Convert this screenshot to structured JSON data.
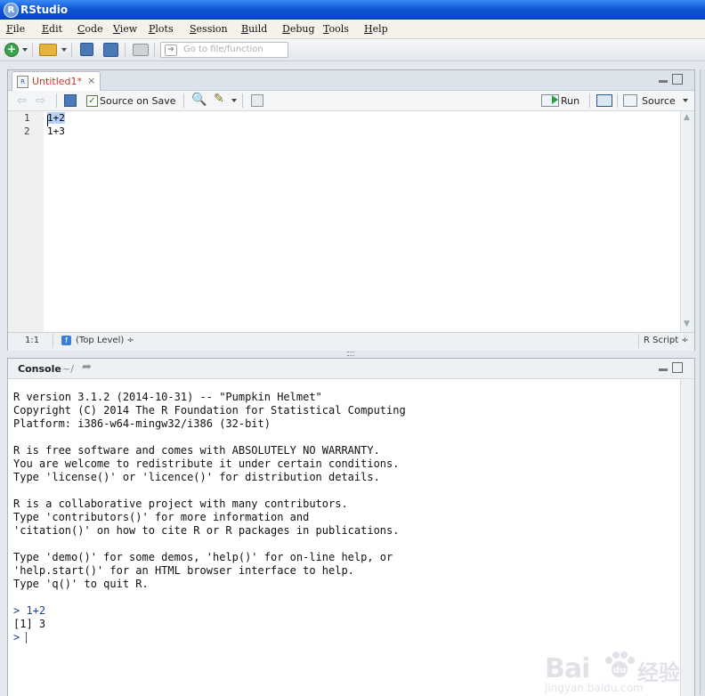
{
  "window": {
    "title": "RStudio"
  },
  "menu": [
    "File",
    "Edit",
    "Code",
    "View",
    "Plots",
    "Session",
    "Build",
    "Debug",
    "Tools",
    "Help"
  ],
  "toolbar": {
    "goto_placeholder": "Go to file/function"
  },
  "editor": {
    "tab_label": "Untitled1*",
    "tab_close": "×",
    "source_on_save_label": "Source on Save",
    "source_on_save_checked": true,
    "run_label": "Run",
    "source_label": "Source",
    "line_numbers": [
      "1",
      "2"
    ],
    "lines": [
      {
        "selected": "1+2",
        "rest": ""
      },
      {
        "selected": "",
        "rest": "1+3"
      }
    ],
    "status_position": "1:1",
    "status_scope": "(Top Level) ÷",
    "status_filetype": "R Script ÷"
  },
  "console": {
    "title": "Console",
    "cwd": "~/",
    "banner": "R version 3.1.2 (2014-10-31) -- \"Pumpkin Helmet\"\nCopyright (C) 2014 The R Foundation for Statistical Computing\nPlatform: i386-w64-mingw32/i386 (32-bit)\n\nR is free software and comes with ABSOLUTELY NO WARRANTY.\nYou are welcome to redistribute it under certain conditions.\nType 'license()' or 'licence()' for distribution details.\n\nR is a collaborative project with many contributors.\nType 'contributors()' for more information and\n'citation()' on how to cite R or R packages in publications.\n\nType 'demo()' for some demos, 'help()' for on-line help, or\n'help.start()' for an HTML browser interface to help.\nType 'q()' to quit R.\n",
    "prompt_symbol": ">",
    "command": " 1+2",
    "result": "[1] 3"
  },
  "watermark": {
    "brand": "Bai",
    "suffix": "经验",
    "url": "jingyan.baidu.com"
  },
  "colors": {
    "titlebar": "#1057d6",
    "tab_modified_text": "#c0392b",
    "selection": "#b6d1f5"
  }
}
